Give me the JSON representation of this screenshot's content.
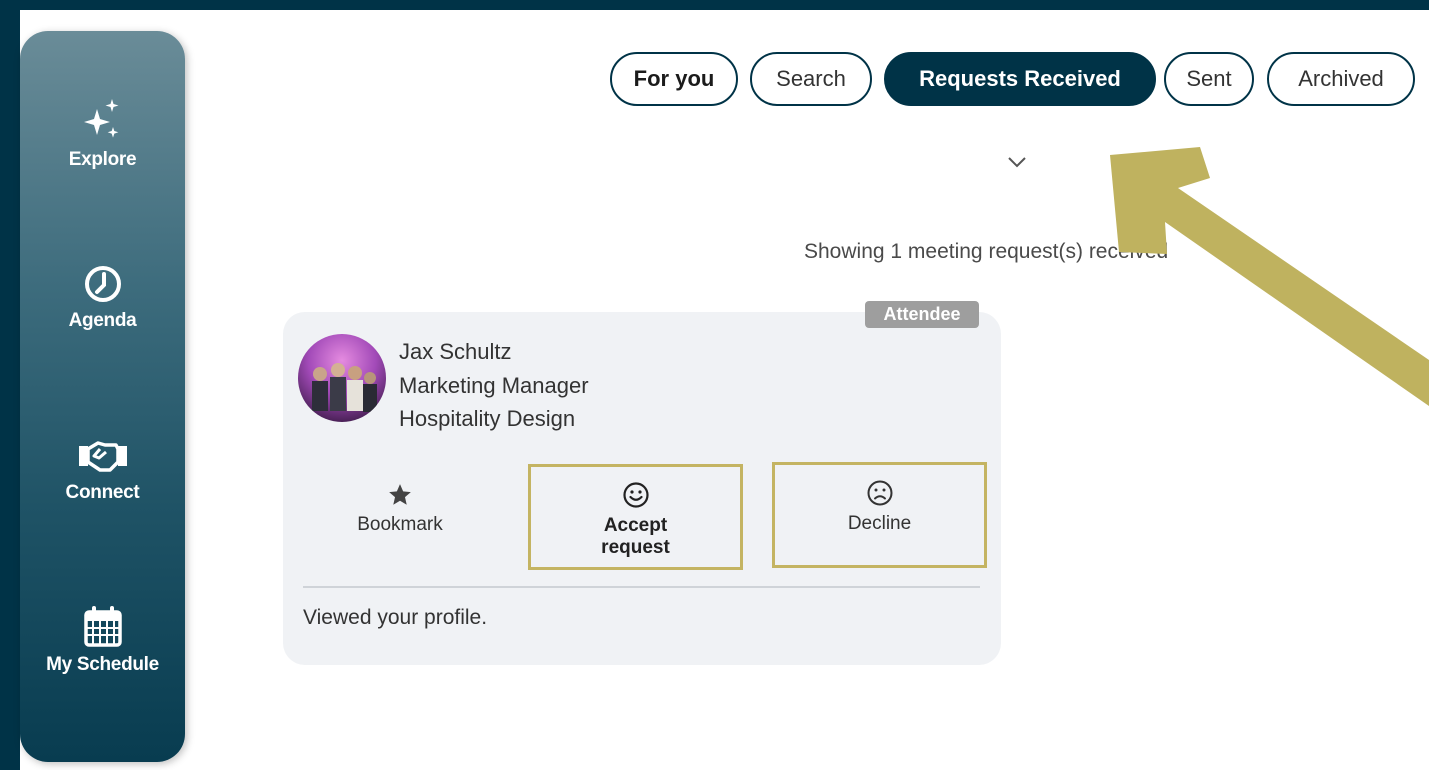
{
  "sidebar": {
    "items": [
      {
        "label": "Explore",
        "icon": "sparkles-icon"
      },
      {
        "label": "Agenda",
        "icon": "clock-icon"
      },
      {
        "label": "Connect",
        "icon": "handshake-icon"
      },
      {
        "label": "My Schedule",
        "icon": "calendar-icon"
      }
    ]
  },
  "tabs": [
    {
      "label": "For you"
    },
    {
      "label": "Search"
    },
    {
      "label": "Requests Received",
      "active": true
    },
    {
      "label": "Sent"
    },
    {
      "label": "Archived"
    }
  ],
  "results": {
    "summary": "Showing 1 meeting request(s) received"
  },
  "request_card": {
    "badge": "Attendee",
    "name": "Jax Schultz",
    "job_title": "Marketing Manager",
    "company": "Hospitality Design",
    "actions": {
      "bookmark": "Bookmark",
      "accept": "Accept request",
      "decline": "Decline"
    },
    "note": "Viewed your profile."
  },
  "colors": {
    "frame": "#003347",
    "active_tab": "#003347",
    "highlight_border": "#c4b462",
    "annotation_arrow": "#bfb25f",
    "card_bg": "#f0f2f5"
  }
}
